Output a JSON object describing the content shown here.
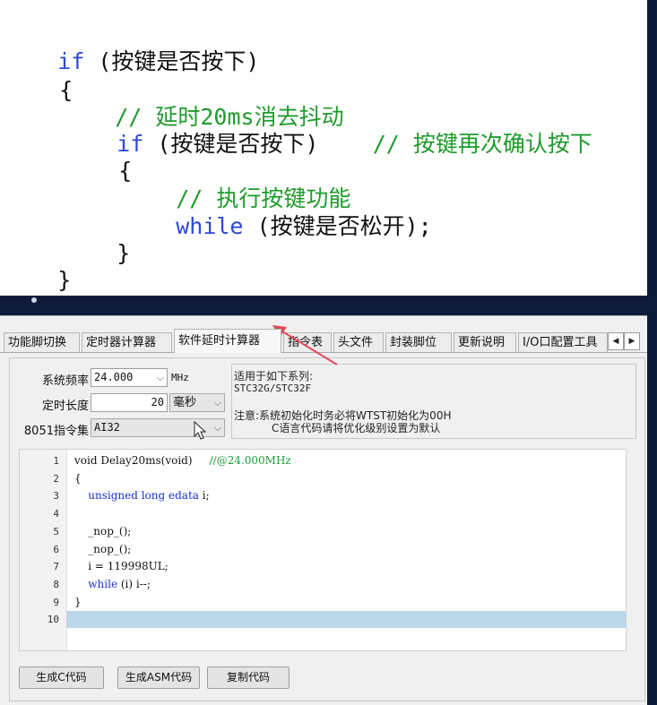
{
  "slide": {
    "lines": [
      {
        "kw": "if",
        "text": " (按键是否按下)",
        "comment": ""
      },
      {
        "kw": "",
        "text": "{",
        "comment": ""
      },
      {
        "kw": "",
        "text": "",
        "comment": "// 延时20ms消去抖动"
      },
      {
        "kw": "if",
        "text": " (按键是否按下)    ",
        "comment": "// 按键再次确认按下"
      },
      {
        "kw": "",
        "text": "{",
        "comment": ""
      },
      {
        "kw": "",
        "text": "",
        "comment": "// 执行按键功能"
      },
      {
        "kw": "while",
        "text": " (按键是否松开);",
        "comment": ""
      },
      {
        "kw": "",
        "text": "}",
        "comment": ""
      },
      {
        "kw": "",
        "text": "}",
        "comment": ""
      }
    ]
  },
  "tabs": [
    {
      "label": "功能脚切换",
      "active": false
    },
    {
      "label": "定时器计算器",
      "active": false
    },
    {
      "label": "软件延时计算器",
      "active": true
    },
    {
      "label": "指令表",
      "active": false
    },
    {
      "label": "头文件",
      "active": false
    },
    {
      "label": "封装脚位",
      "active": false
    },
    {
      "label": "更新说明",
      "active": false
    },
    {
      "label": "I/O口配置工具",
      "active": false
    }
  ],
  "tab_scroll": {
    "left": "◀",
    "right": "▶"
  },
  "settings": {
    "freq_label": "系统频率",
    "freq_value": "24.000",
    "freq_unit": "MHz",
    "duration_label": "定时长度",
    "duration_value": "20",
    "duration_unit": "毫秒",
    "isa_label": "8051指令集",
    "isa_value": "AI32"
  },
  "info": {
    "line1": "适用于如下系列:",
    "line2": "STC32G/STC32F",
    "line3": "注意:系统初始化时务必将WTST初始化为00H",
    "line4": "C语言代码请将优化级别设置为默认"
  },
  "code": [
    {
      "num": "1",
      "parts": [
        {
          "t": "void Delay20ms(void)     ",
          "c": ""
        },
        {
          "t": "//@24.000MHz",
          "c": "cm2"
        }
      ]
    },
    {
      "num": "2",
      "parts": [
        {
          "t": "{",
          "c": ""
        }
      ]
    },
    {
      "num": "3",
      "parts": [
        {
          "t": "    ",
          "c": ""
        },
        {
          "t": "unsigned long edata",
          "c": "kw2"
        },
        {
          "t": " i;",
          "c": ""
        }
      ]
    },
    {
      "num": "4",
      "parts": []
    },
    {
      "num": "5",
      "parts": [
        {
          "t": "    _nop_();",
          "c": ""
        }
      ]
    },
    {
      "num": "6",
      "parts": [
        {
          "t": "    _nop_();",
          "c": ""
        }
      ]
    },
    {
      "num": "7",
      "parts": [
        {
          "t": "    i = 119998UL;",
          "c": ""
        }
      ]
    },
    {
      "num": "8",
      "parts": [
        {
          "t": "    ",
          "c": ""
        },
        {
          "t": "while",
          "c": "kw2"
        },
        {
          "t": " (i) i--;",
          "c": ""
        }
      ]
    },
    {
      "num": "9",
      "parts": [
        {
          "t": "}",
          "c": ""
        }
      ]
    },
    {
      "num": "10",
      "parts": []
    }
  ],
  "buttons": {
    "gen_c": "生成C代码",
    "gen_asm": "生成ASM代码",
    "copy": "复制代码"
  },
  "colors": {
    "keyword_slide": "#2b48d6",
    "comment_slide": "#1f9b2b",
    "current_line": "#bcd7e8",
    "annotation_arrow": "#e04a5a"
  }
}
